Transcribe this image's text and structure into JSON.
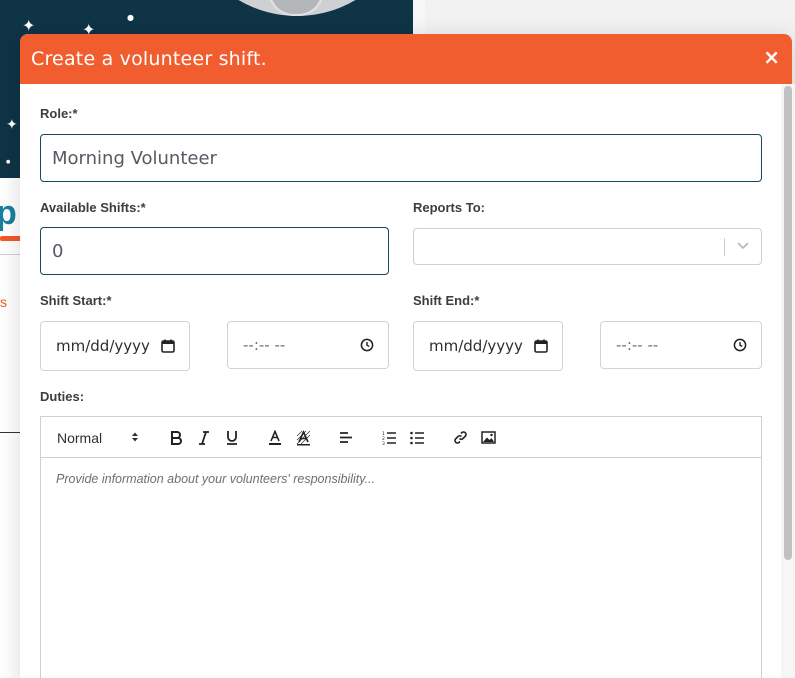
{
  "modal": {
    "title": "Create a volunteer shift.",
    "close_label": "×"
  },
  "form": {
    "role": {
      "label": "Role:*",
      "value": "Morning Volunteer"
    },
    "available_shifts": {
      "label": "Available Shifts:*",
      "value": "0"
    },
    "reports_to": {
      "label": "Reports To:",
      "value": ""
    },
    "shift_start": {
      "label": "Shift Start:*",
      "date_placeholder": "mm/dd/yyyy",
      "time_placeholder": "--:-- --"
    },
    "shift_end": {
      "label": "Shift End:*",
      "date_placeholder": "mm/dd/yyyy",
      "time_placeholder": "--:-- --"
    },
    "duties": {
      "label": "Duties:",
      "placeholder": "Provide information about your volunteers' responsibility...",
      "format_select": "Normal"
    }
  },
  "background": {
    "brand_fragment": "p",
    "link_fragment": "s"
  },
  "colors": {
    "header": "#f15d2f",
    "input_border_focus": "#17495c",
    "hero": "#0f3446"
  },
  "icons": {
    "calendar": "calendar-icon",
    "clock": "clock-icon",
    "chevron": "chevron-down-icon",
    "close": "close-icon"
  }
}
